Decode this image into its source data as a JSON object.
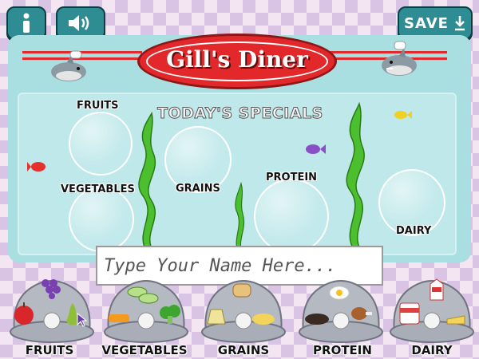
{
  "toolbar": {
    "info_icon": "info-icon",
    "sound_icon": "speaker-icon",
    "save_label": "SAVE",
    "save_icon": "download-icon"
  },
  "sign": {
    "title": "Gill's Diner"
  },
  "specials": {
    "heading": "TODAY'S SPECIALS",
    "bubbles": [
      "FRUITS",
      "VEGETABLES",
      "GRAINS",
      "PROTEIN",
      "DAIRY"
    ]
  },
  "name_input": {
    "placeholder": "Type Your Name Here...",
    "value": ""
  },
  "trays": [
    {
      "label": "FRUITS"
    },
    {
      "label": "VEGETABLES"
    },
    {
      "label": "GRAINS"
    },
    {
      "label": "PROTEIN"
    },
    {
      "label": "DAIRY"
    }
  ],
  "colors": {
    "button": "#2e8d93",
    "panel": "#a9dfe1",
    "sign_red": "#e2282a",
    "seaweed": "#4cbf2e"
  }
}
